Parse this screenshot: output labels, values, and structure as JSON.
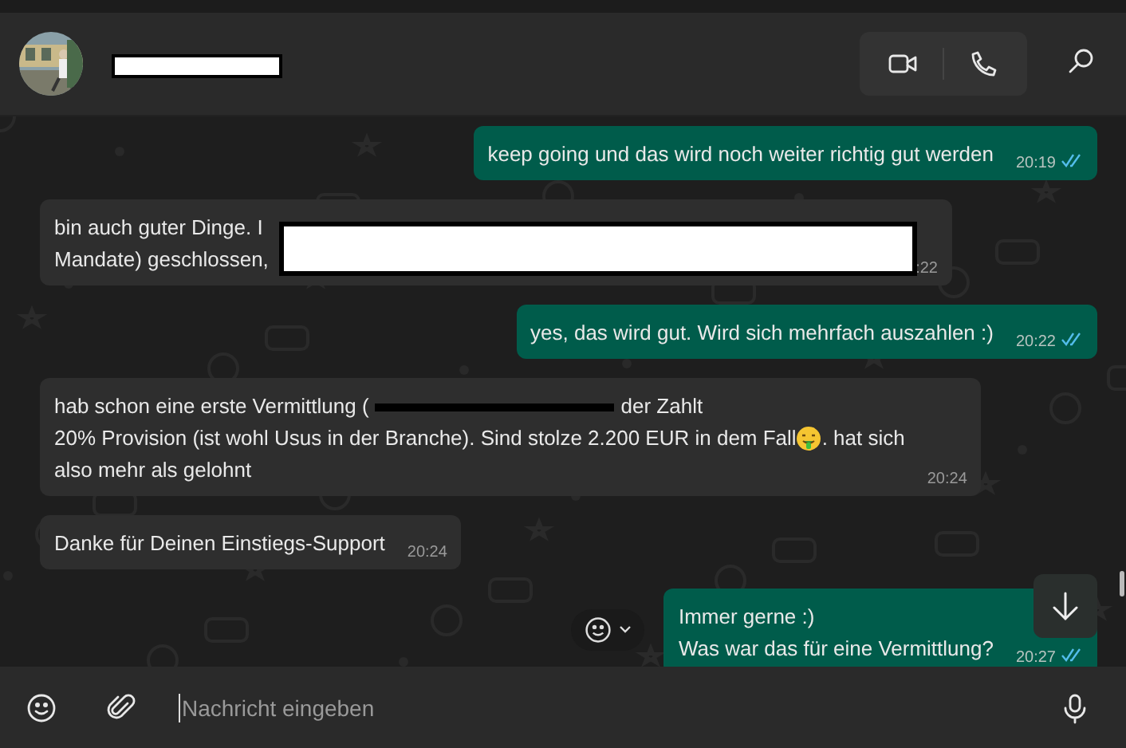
{
  "header": {
    "redaction": {
      "kind": "box"
    },
    "actions": [
      {
        "kind": "video"
      },
      {
        "kind": "phone"
      }
    ]
  },
  "messages": [
    {
      "outgoing": true,
      "time": "20:19",
      "read": true,
      "lines": [
        [
          {
            "kind": "text",
            "text": "keep going und das wird noch weiter richtig gut werden"
          }
        ]
      ]
    },
    {
      "outgoing": false,
      "time": ":22",
      "redaction": {
        "kind": "box"
      },
      "lines": [
        [
          {
            "kind": "text",
            "text": "bin auch guter Dinge. I"
          }
        ],
        [
          {
            "kind": "text",
            "text": "Mandate) geschlossen,"
          }
        ]
      ]
    },
    {
      "outgoing": true,
      "time": "20:22",
      "read": true,
      "lines": [
        [
          {
            "kind": "text",
            "text": "yes, das wird gut. Wird sich mehrfach auszahlen :)"
          }
        ]
      ]
    },
    {
      "outgoing": false,
      "time": "20:24",
      "lines": [
        [
          {
            "kind": "text",
            "text": "hab schon eine erste Vermittlung ("
          },
          {
            "kind": "strike"
          },
          {
            "kind": "text",
            "text": "der Zahlt"
          }
        ],
        [
          {
            "kind": "text",
            "text": "20% Provision (ist wohl Usus in der Branche). Sind stolze 2.200 EUR in dem Fall"
          },
          {
            "kind": "emoji"
          },
          {
            "kind": "text",
            "text": ". hat sich"
          }
        ],
        [
          {
            "kind": "text",
            "text": "also mehr als gelohnt"
          }
        ]
      ]
    },
    {
      "outgoing": false,
      "time": "20:24",
      "lines": [
        [
          {
            "kind": "text",
            "text": "Danke für Deinen Einstiegs-Support"
          }
        ]
      ]
    },
    {
      "outgoing": true,
      "time": "20:27",
      "read": true,
      "lines": [
        [
          {
            "kind": "text",
            "text": "Immer gerne :)"
          }
        ],
        [
          {
            "kind": "text",
            "text": "Was war das für eine Vermittlung?"
          }
        ]
      ]
    }
  ],
  "composer": {
    "placeholder": "Nachricht eingeben"
  }
}
